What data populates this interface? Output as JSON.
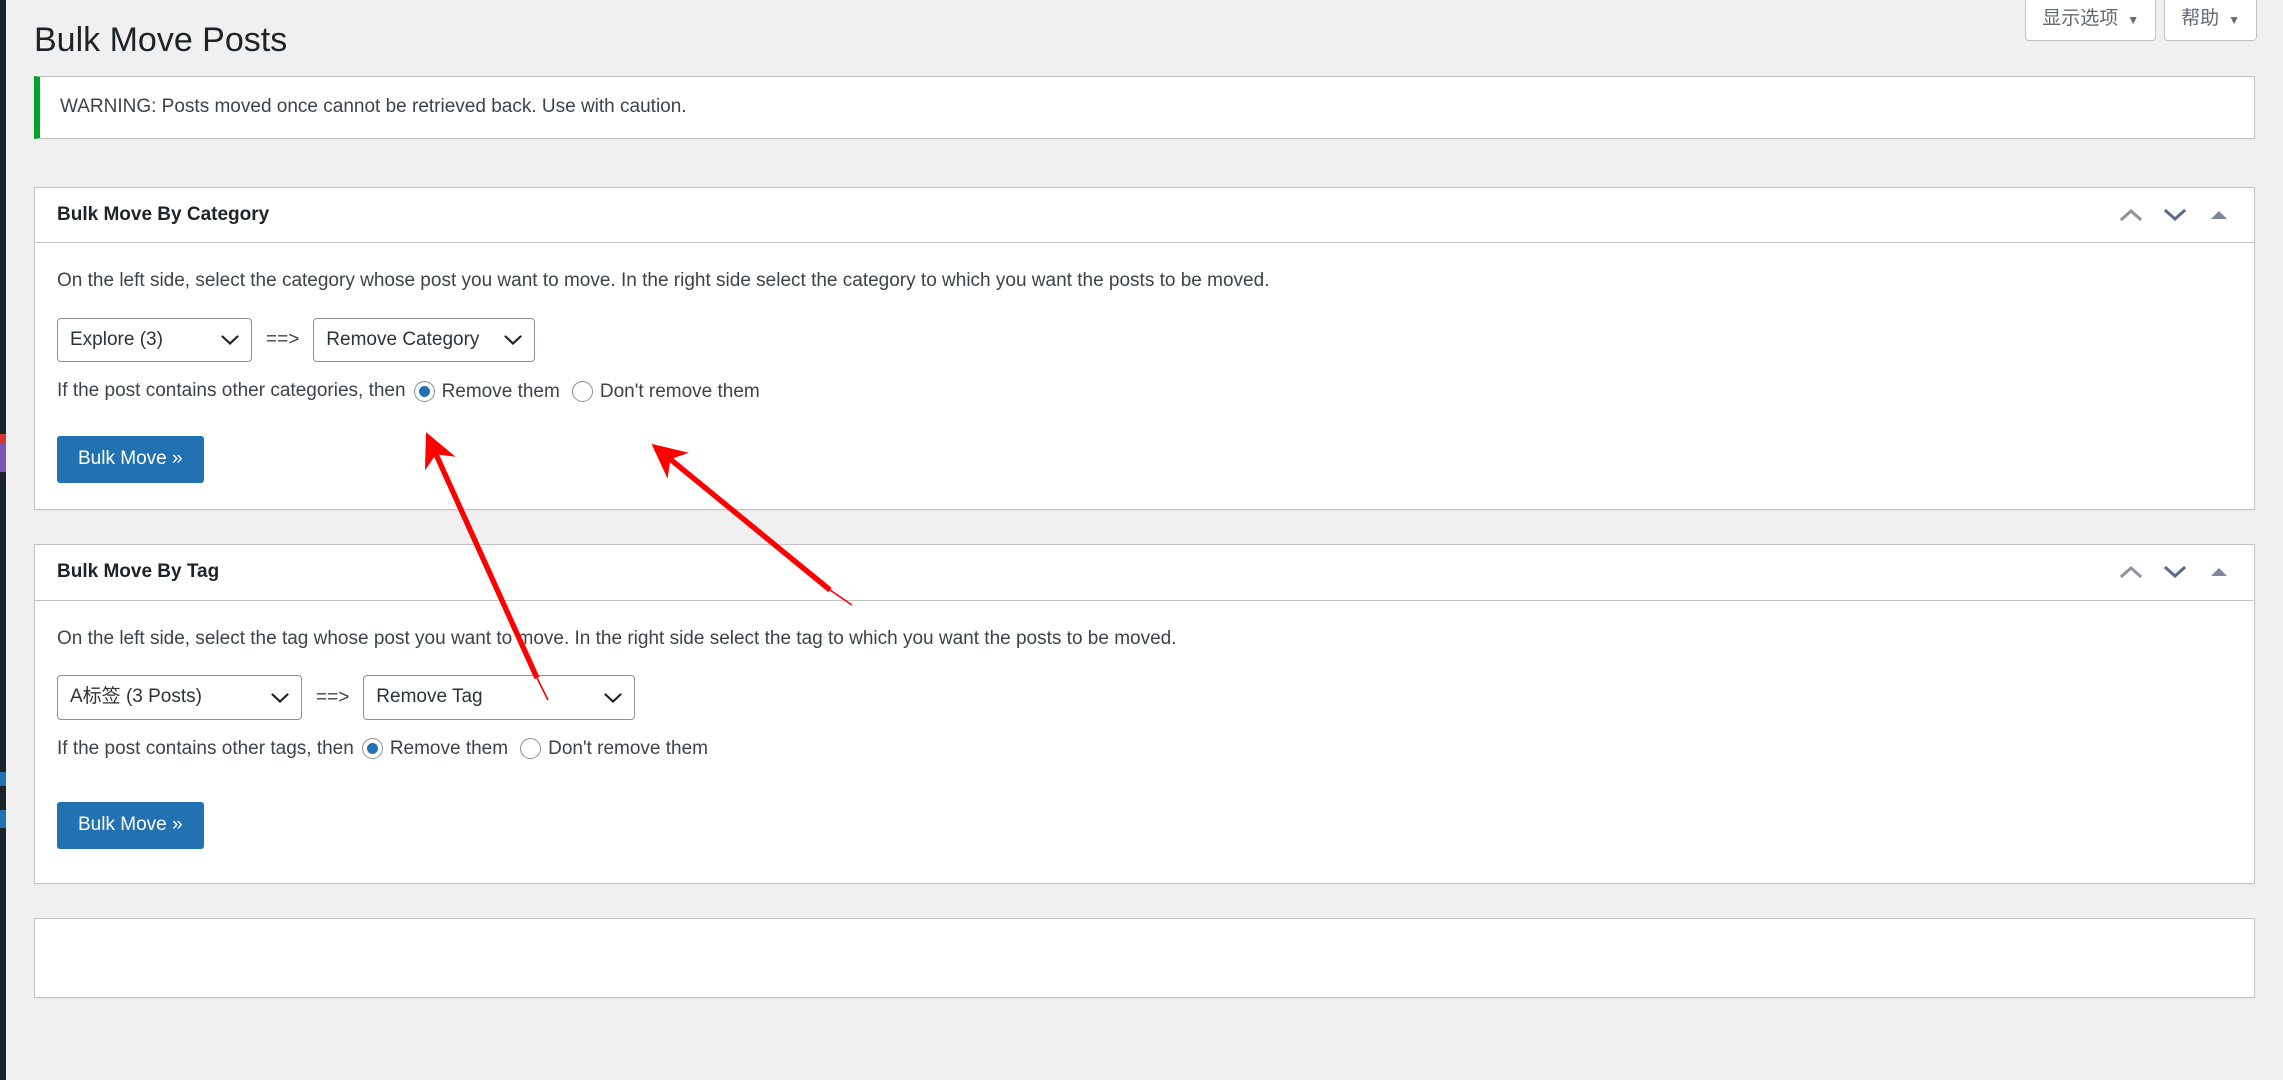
{
  "screen_meta": {
    "buttons": [
      {
        "label": "显示选项",
        "caret": "▼",
        "name": "show-settings-link"
      },
      {
        "label": "帮助",
        "caret": "▼",
        "name": "contextual-help-link"
      }
    ]
  },
  "page": {
    "title": "Bulk Move Posts"
  },
  "notice": {
    "text": "WARNING: Posts moved once cannot be retrieved back. Use with caution.",
    "border_color": "#00a32a"
  },
  "handle_icons": {
    "move_up": "chevron-up-icon",
    "move_down": "chevron-down-icon",
    "toggle": "triangle-up-icon"
  },
  "category_box": {
    "heading": "Bulk Move By Category",
    "helper_text": "On the left side, select the category whose post you want to move. In the right side select the category to which you want the posts to be moved.",
    "source_select": {
      "value": "Explore  (3)",
      "options": [
        "Explore  (3)"
      ]
    },
    "arrow": "==>",
    "target_select": {
      "value": "Remove Category",
      "options": [
        "Remove Category"
      ]
    },
    "radio_group": {
      "lead_text": "If the post contains other categories, then",
      "options": [
        {
          "label": "Remove them",
          "checked": true
        },
        {
          "label": "Don't remove them",
          "checked": false
        }
      ]
    },
    "submit_label": "Bulk Move »"
  },
  "tag_box": {
    "heading": "Bulk Move By Tag",
    "helper_text": "On the left side, select the tag whose post you want to move. In the right side select the tag to which you want the posts to be moved.",
    "source_select": {
      "value": "A标签 (3 Posts)",
      "options": [
        "A标签 (3 Posts)"
      ]
    },
    "arrow": "==>",
    "target_select": {
      "value": "Remove Tag",
      "options": [
        "Remove Tag"
      ]
    },
    "radio_group": {
      "lead_text": "If the post contains other tags, then",
      "options": [
        {
          "label": "Remove them",
          "checked": true
        },
        {
          "label": "Don't remove them",
          "checked": false
        }
      ]
    },
    "submit_label": "Bulk Move »"
  },
  "colors": {
    "primary": "#2271b1",
    "notice_success": "#00a32a",
    "admin_dark": "#1d2327",
    "page_bg": "#f0f0f1",
    "annotation_red": "#ff0000"
  },
  "annotations": {
    "arrow_count": 2,
    "arrow_1_target": "Remove them radio (category)",
    "arrow_2_target": "Don't remove them radio (category)"
  }
}
